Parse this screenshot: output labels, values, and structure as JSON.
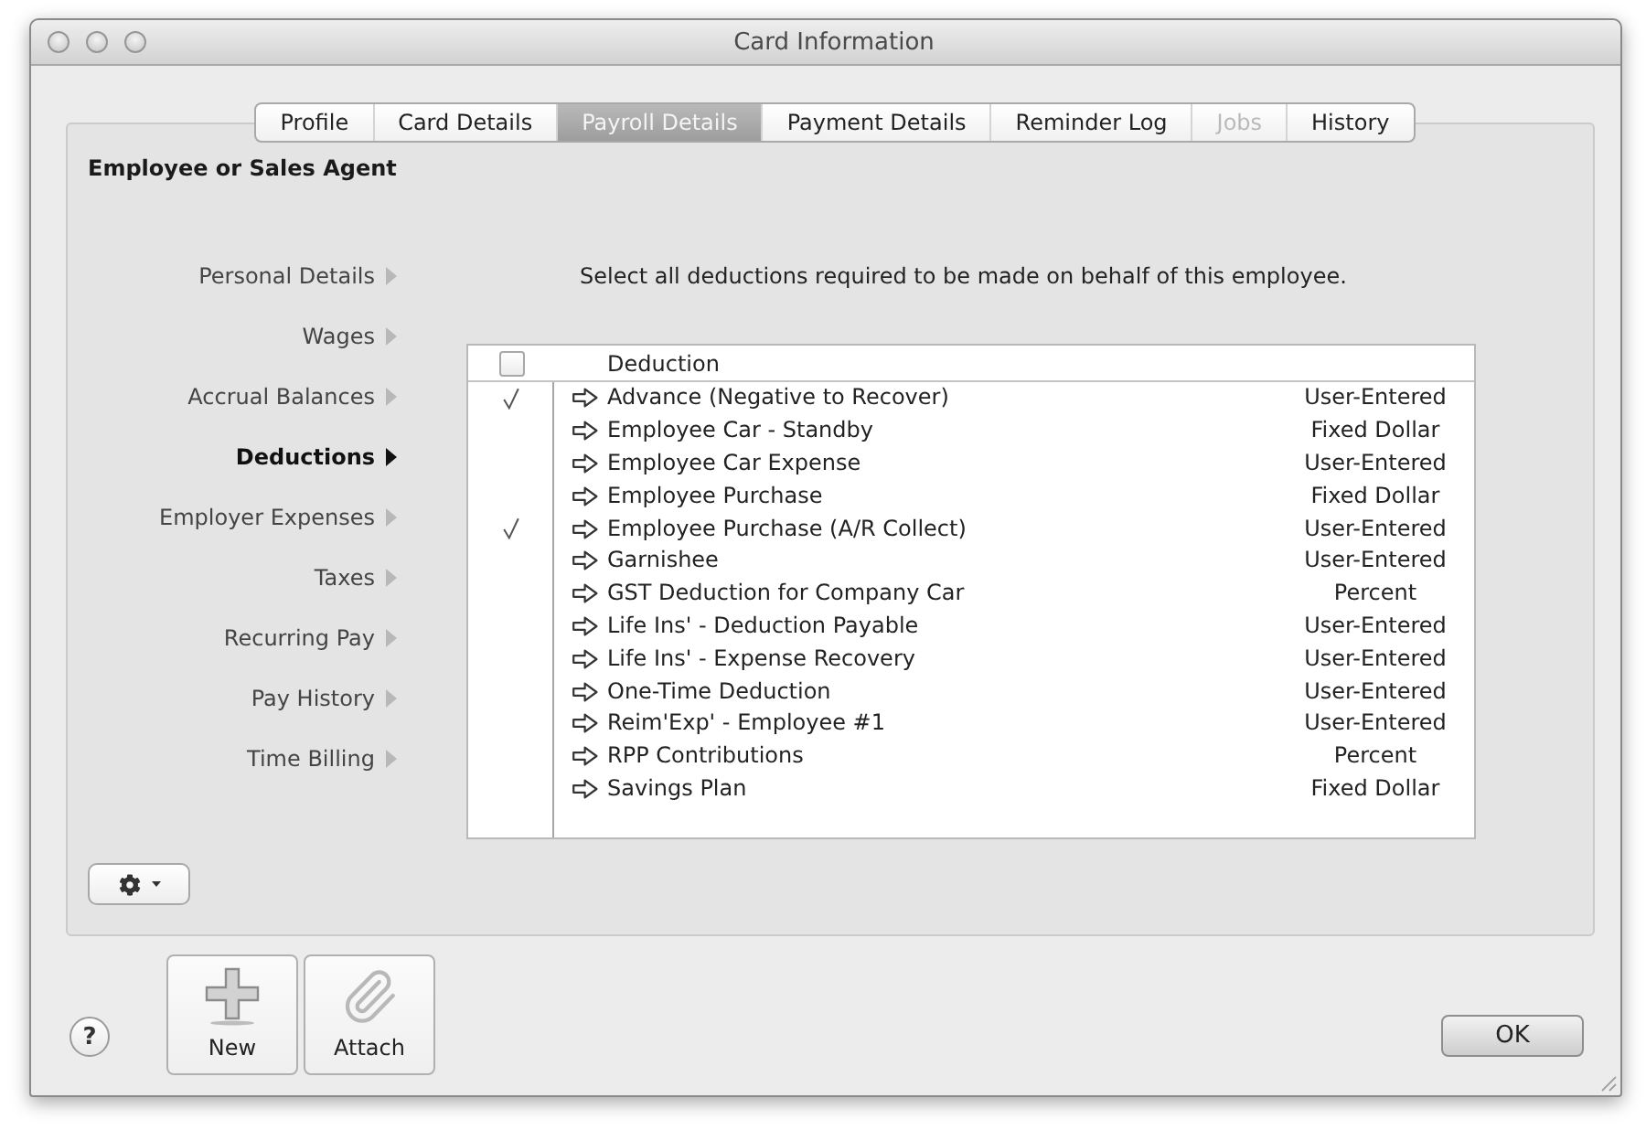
{
  "window": {
    "title": "Card Information"
  },
  "tabs": [
    {
      "label": "Profile",
      "selected": false,
      "disabled": false
    },
    {
      "label": "Card Details",
      "selected": false,
      "disabled": false
    },
    {
      "label": "Payroll Details",
      "selected": true,
      "disabled": false
    },
    {
      "label": "Payment Details",
      "selected": false,
      "disabled": false
    },
    {
      "label": "Reminder Log",
      "selected": false,
      "disabled": false
    },
    {
      "label": "Jobs",
      "selected": false,
      "disabled": true
    },
    {
      "label": "History",
      "selected": false,
      "disabled": false
    }
  ],
  "panel": {
    "title": "Employee or Sales Agent"
  },
  "sidebar": {
    "items": [
      {
        "label": "Personal Details",
        "selected": false
      },
      {
        "label": "Wages",
        "selected": false
      },
      {
        "label": "Accrual Balances",
        "selected": false
      },
      {
        "label": "Deductions",
        "selected": true
      },
      {
        "label": "Employer Expenses",
        "selected": false
      },
      {
        "label": "Taxes",
        "selected": false
      },
      {
        "label": "Recurring Pay",
        "selected": false
      },
      {
        "label": "Pay History",
        "selected": false
      },
      {
        "label": "Time Billing",
        "selected": false
      }
    ]
  },
  "instruction": "Select all deductions required to be made on behalf of this employee.",
  "table": {
    "select_all_checked": false,
    "column_header": "Deduction",
    "rows": [
      {
        "checked": true,
        "name": "Advance (Negative to Recover)",
        "type": "User-Entered"
      },
      {
        "checked": false,
        "name": "Employee Car - Standby",
        "type": "Fixed Dollar"
      },
      {
        "checked": false,
        "name": "Employee Car Expense",
        "type": "User-Entered"
      },
      {
        "checked": false,
        "name": "Employee Purchase",
        "type": "Fixed Dollar"
      },
      {
        "checked": true,
        "name": "Employee Purchase (A/R Collect)",
        "type": "User-Entered"
      },
      {
        "checked": false,
        "name": "Garnishee",
        "type": "User-Entered"
      },
      {
        "checked": false,
        "name": "GST Deduction for Company Car",
        "type": "Percent"
      },
      {
        "checked": false,
        "name": "Life Ins' - Deduction Payable",
        "type": "User-Entered"
      },
      {
        "checked": false,
        "name": "Life Ins' - Expense Recovery",
        "type": "User-Entered"
      },
      {
        "checked": false,
        "name": "One-Time Deduction",
        "type": "User-Entered"
      },
      {
        "checked": false,
        "name": "Reim'Exp' - Employee #1",
        "type": "User-Entered"
      },
      {
        "checked": false,
        "name": "RPP Contributions",
        "type": "Percent"
      },
      {
        "checked": false,
        "name": "Savings Plan",
        "type": "Fixed Dollar"
      }
    ]
  },
  "footer": {
    "help": "?",
    "buttons": [
      {
        "kind": "new",
        "label": "New"
      },
      {
        "kind": "attach",
        "label": "Attach"
      }
    ],
    "ok": "OK"
  }
}
